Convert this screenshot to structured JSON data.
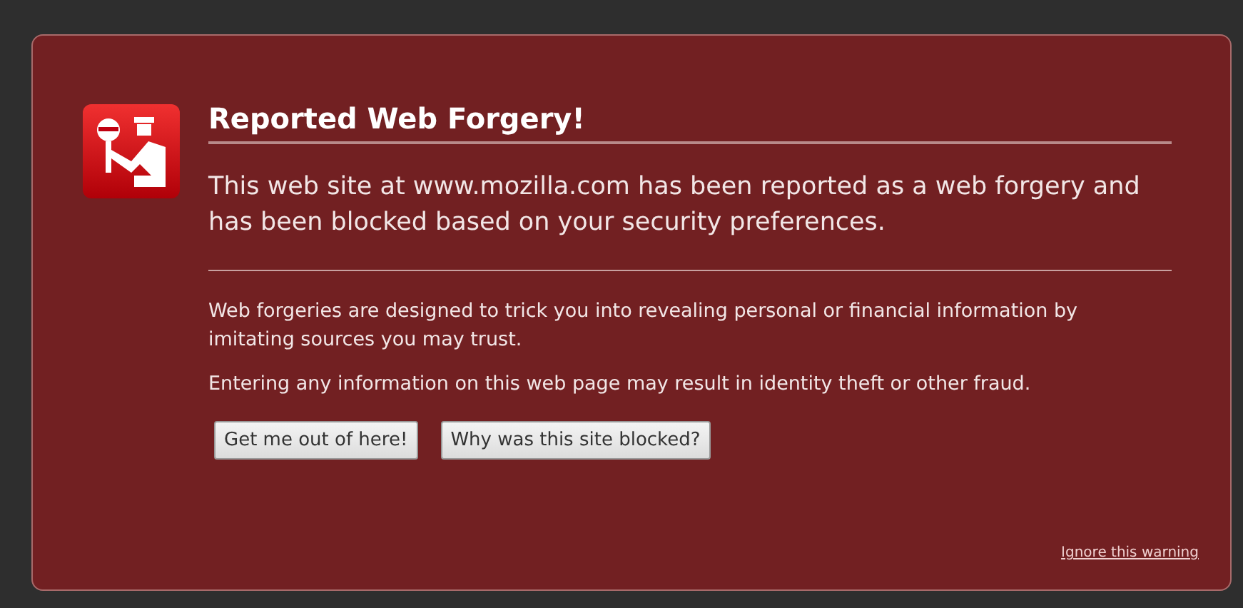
{
  "title": "Reported Web Forgery!",
  "short_description": "This web site at www.mozilla.com has been reported as a web forgery and has been blocked based on your security preferences.",
  "long_description": [
    "Web forgeries are designed to trick you into revealing personal or financial information by imitating sources you may trust.",
    "Entering any information on this web page may result in identity theft or other fraud."
  ],
  "buttons": [
    "Get me out of here!",
    "Why was this site blocked?"
  ],
  "ignore_link": "Ignore this warning"
}
